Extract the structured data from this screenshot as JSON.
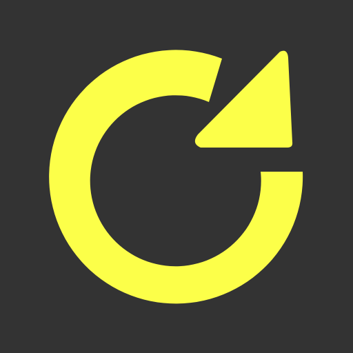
{
  "icon": {
    "name": "refresh-icon",
    "background_color": "#333333",
    "foreground_color": "#FCFF49"
  }
}
